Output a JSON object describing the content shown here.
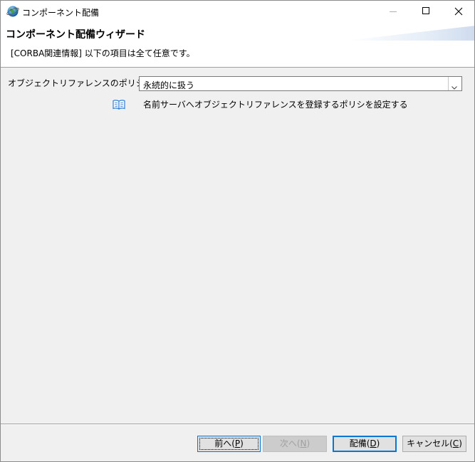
{
  "window": {
    "title": "コンポーネント配備"
  },
  "banner": {
    "title": "コンポーネント配備ウィザード",
    "description": "[CORBA関連情報] 以下の項目は全て任意です。"
  },
  "form": {
    "policy_label": "オブジェクトリファレンスのポリシ",
    "policy_value": "永続的に扱う",
    "help_text": "名前サーバへオブジェクトリファレンスを登録するポリシを設定する"
  },
  "buttons": {
    "back": {
      "label": "前へ(",
      "mnemonic": "P",
      "suffix": ")"
    },
    "next": {
      "label": "次へ(",
      "mnemonic": "N",
      "suffix": ")"
    },
    "deploy": {
      "label": "配備(",
      "mnemonic": "D",
      "suffix": ")"
    },
    "cancel": {
      "label": "キャンセル(",
      "mnemonic": "C",
      "suffix": ")"
    }
  },
  "icons": {
    "app": "globe-icon",
    "help": "book-icon",
    "minimize": "minimize-icon",
    "maximize": "maximize-icon",
    "close": "close-icon",
    "dropdown": "chevron-down-icon"
  },
  "colors": {
    "accent": "#0078d7",
    "dialog_bg": "#f0f0f0",
    "disabled_text": "#a0a0a0"
  }
}
